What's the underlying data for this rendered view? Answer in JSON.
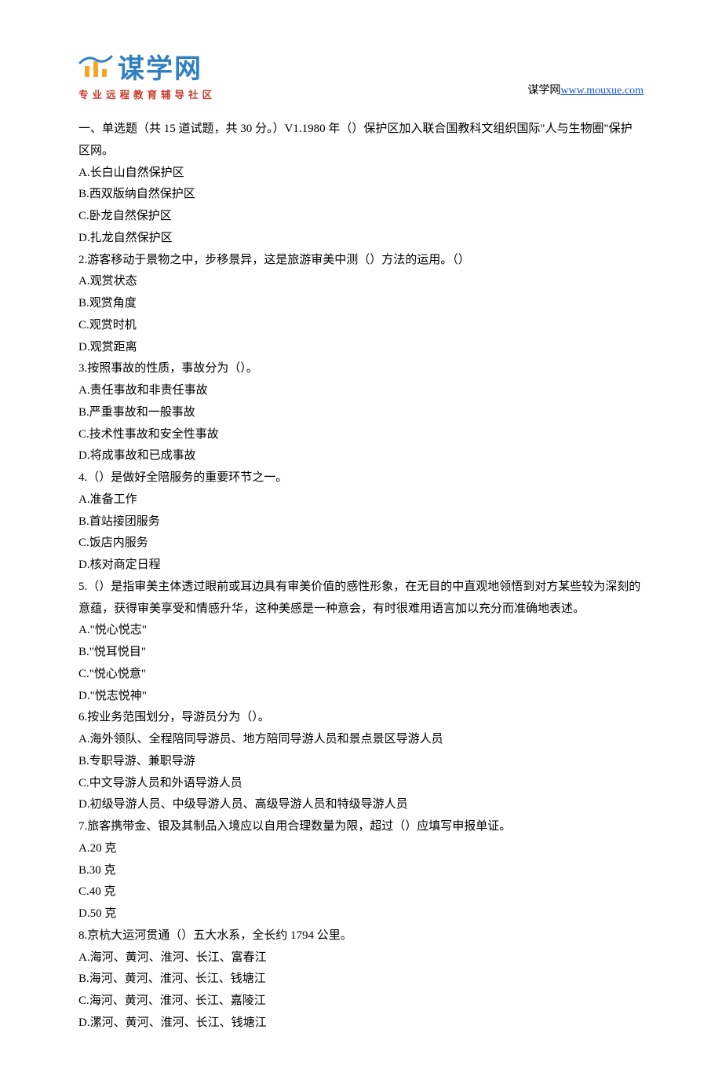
{
  "header": {
    "logo_main": "谋学网",
    "logo_sub": "专业远程教育辅导社区",
    "site_label": "谋学网",
    "site_url": "www.mouxue.com"
  },
  "section_intro": "一、单选题（共 15 道试题，共 30 分。）V",
  "questions": [
    {
      "stem": "1.1980 年（）保护区加入联合国教科文组织国际\"人与生物圈\"保护区网。",
      "options": [
        "A.长白山自然保护区",
        "B.西双版纳自然保护区",
        "C.卧龙自然保护区",
        "D.扎龙自然保护区"
      ]
    },
    {
      "stem": "2.游客移动于景物之中，步移景异，这是旅游审美中测（）方法的运用。（）",
      "options": [
        "A.观赏状态",
        "B.观赏角度",
        "C.观赏时机",
        "D.观赏距离"
      ]
    },
    {
      "stem": "3.按照事故的性质，事故分为（）。",
      "options": [
        "A.责任事故和非责任事故",
        "B.严重事故和一般事故",
        "C.技术性事故和安全性事故",
        "D.将成事故和已成事故"
      ]
    },
    {
      "stem": "4.（）是做好全陪服务的重要环节之一。",
      "options": [
        "A.准备工作",
        "B.首站接团服务",
        "C.饭店内服务",
        "D.核对商定日程"
      ]
    },
    {
      "stem": "5.（）是指审美主体透过眼前或耳边具有审美价值的感性形象，在无目的中直观地领悟到对方某些较为深刻的意蕴，获得审美享受和情感升华，这种美感是一种意会，有时很难用语言加以充分而准确地表述。",
      "options": [
        "A.\"悦心悦志\"",
        "B.\"悦耳悦目\"",
        "C.\"悦心悦意\"",
        "D.\"悦志悦神\""
      ]
    },
    {
      "stem": "6.按业务范围划分，导游员分为（）。",
      "options": [
        "A.海外领队、全程陪同导游员、地方陪同导游人员和景点景区导游人员",
        "B.专职导游、兼职导游",
        "C.中文导游人员和外语导游人员",
        "D.初级导游人员、中级导游人员、高级导游人员和特级导游人员"
      ]
    },
    {
      "stem": "7.旅客携带金、银及其制品入境应以自用合理数量为限，超过（）应填写申报单证。",
      "options": [
        "A.20 克",
        "B.30 克",
        "C.40 克",
        "D.50 克"
      ]
    },
    {
      "stem": "8.京杭大运河贯通（）五大水系，全长约 1794 公里。",
      "options": [
        "A.海河、黄河、淮河、长江、富春江",
        "B.海河、黄河、淮河、长江、钱塘江",
        "C.海河、黄河、淮河、长江、嘉陵江",
        "D.漯河、黄河、淮河、长江、钱塘江"
      ]
    }
  ]
}
